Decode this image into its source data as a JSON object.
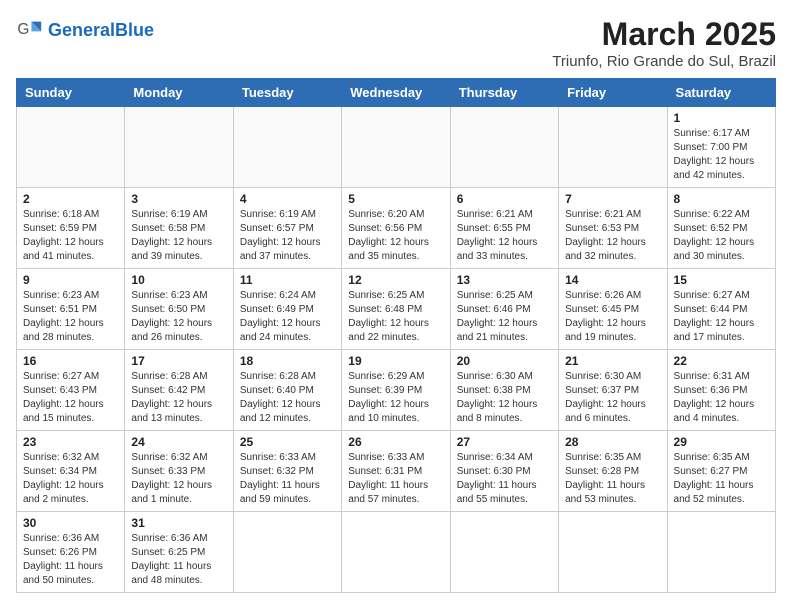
{
  "header": {
    "logo_text_normal": "General",
    "logo_text_bold": "Blue",
    "title": "March 2025",
    "subtitle": "Triunfo, Rio Grande do Sul, Brazil"
  },
  "days_of_week": [
    "Sunday",
    "Monday",
    "Tuesday",
    "Wednesday",
    "Thursday",
    "Friday",
    "Saturday"
  ],
  "weeks": [
    [
      {
        "day": "",
        "info": ""
      },
      {
        "day": "",
        "info": ""
      },
      {
        "day": "",
        "info": ""
      },
      {
        "day": "",
        "info": ""
      },
      {
        "day": "",
        "info": ""
      },
      {
        "day": "",
        "info": ""
      },
      {
        "day": "1",
        "info": "Sunrise: 6:17 AM\nSunset: 7:00 PM\nDaylight: 12 hours and 42 minutes."
      }
    ],
    [
      {
        "day": "2",
        "info": "Sunrise: 6:18 AM\nSunset: 6:59 PM\nDaylight: 12 hours and 41 minutes."
      },
      {
        "day": "3",
        "info": "Sunrise: 6:19 AM\nSunset: 6:58 PM\nDaylight: 12 hours and 39 minutes."
      },
      {
        "day": "4",
        "info": "Sunrise: 6:19 AM\nSunset: 6:57 PM\nDaylight: 12 hours and 37 minutes."
      },
      {
        "day": "5",
        "info": "Sunrise: 6:20 AM\nSunset: 6:56 PM\nDaylight: 12 hours and 35 minutes."
      },
      {
        "day": "6",
        "info": "Sunrise: 6:21 AM\nSunset: 6:55 PM\nDaylight: 12 hours and 33 minutes."
      },
      {
        "day": "7",
        "info": "Sunrise: 6:21 AM\nSunset: 6:53 PM\nDaylight: 12 hours and 32 minutes."
      },
      {
        "day": "8",
        "info": "Sunrise: 6:22 AM\nSunset: 6:52 PM\nDaylight: 12 hours and 30 minutes."
      }
    ],
    [
      {
        "day": "9",
        "info": "Sunrise: 6:23 AM\nSunset: 6:51 PM\nDaylight: 12 hours and 28 minutes."
      },
      {
        "day": "10",
        "info": "Sunrise: 6:23 AM\nSunset: 6:50 PM\nDaylight: 12 hours and 26 minutes."
      },
      {
        "day": "11",
        "info": "Sunrise: 6:24 AM\nSunset: 6:49 PM\nDaylight: 12 hours and 24 minutes."
      },
      {
        "day": "12",
        "info": "Sunrise: 6:25 AM\nSunset: 6:48 PM\nDaylight: 12 hours and 22 minutes."
      },
      {
        "day": "13",
        "info": "Sunrise: 6:25 AM\nSunset: 6:46 PM\nDaylight: 12 hours and 21 minutes."
      },
      {
        "day": "14",
        "info": "Sunrise: 6:26 AM\nSunset: 6:45 PM\nDaylight: 12 hours and 19 minutes."
      },
      {
        "day": "15",
        "info": "Sunrise: 6:27 AM\nSunset: 6:44 PM\nDaylight: 12 hours and 17 minutes."
      }
    ],
    [
      {
        "day": "16",
        "info": "Sunrise: 6:27 AM\nSunset: 6:43 PM\nDaylight: 12 hours and 15 minutes."
      },
      {
        "day": "17",
        "info": "Sunrise: 6:28 AM\nSunset: 6:42 PM\nDaylight: 12 hours and 13 minutes."
      },
      {
        "day": "18",
        "info": "Sunrise: 6:28 AM\nSunset: 6:40 PM\nDaylight: 12 hours and 12 minutes."
      },
      {
        "day": "19",
        "info": "Sunrise: 6:29 AM\nSunset: 6:39 PM\nDaylight: 12 hours and 10 minutes."
      },
      {
        "day": "20",
        "info": "Sunrise: 6:30 AM\nSunset: 6:38 PM\nDaylight: 12 hours and 8 minutes."
      },
      {
        "day": "21",
        "info": "Sunrise: 6:30 AM\nSunset: 6:37 PM\nDaylight: 12 hours and 6 minutes."
      },
      {
        "day": "22",
        "info": "Sunrise: 6:31 AM\nSunset: 6:36 PM\nDaylight: 12 hours and 4 minutes."
      }
    ],
    [
      {
        "day": "23",
        "info": "Sunrise: 6:32 AM\nSunset: 6:34 PM\nDaylight: 12 hours and 2 minutes."
      },
      {
        "day": "24",
        "info": "Sunrise: 6:32 AM\nSunset: 6:33 PM\nDaylight: 12 hours and 1 minute."
      },
      {
        "day": "25",
        "info": "Sunrise: 6:33 AM\nSunset: 6:32 PM\nDaylight: 11 hours and 59 minutes."
      },
      {
        "day": "26",
        "info": "Sunrise: 6:33 AM\nSunset: 6:31 PM\nDaylight: 11 hours and 57 minutes."
      },
      {
        "day": "27",
        "info": "Sunrise: 6:34 AM\nSunset: 6:30 PM\nDaylight: 11 hours and 55 minutes."
      },
      {
        "day": "28",
        "info": "Sunrise: 6:35 AM\nSunset: 6:28 PM\nDaylight: 11 hours and 53 minutes."
      },
      {
        "day": "29",
        "info": "Sunrise: 6:35 AM\nSunset: 6:27 PM\nDaylight: 11 hours and 52 minutes."
      }
    ],
    [
      {
        "day": "30",
        "info": "Sunrise: 6:36 AM\nSunset: 6:26 PM\nDaylight: 11 hours and 50 minutes."
      },
      {
        "day": "31",
        "info": "Sunrise: 6:36 AM\nSunset: 6:25 PM\nDaylight: 11 hours and 48 minutes."
      },
      {
        "day": "",
        "info": ""
      },
      {
        "day": "",
        "info": ""
      },
      {
        "day": "",
        "info": ""
      },
      {
        "day": "",
        "info": ""
      },
      {
        "day": "",
        "info": ""
      }
    ]
  ]
}
